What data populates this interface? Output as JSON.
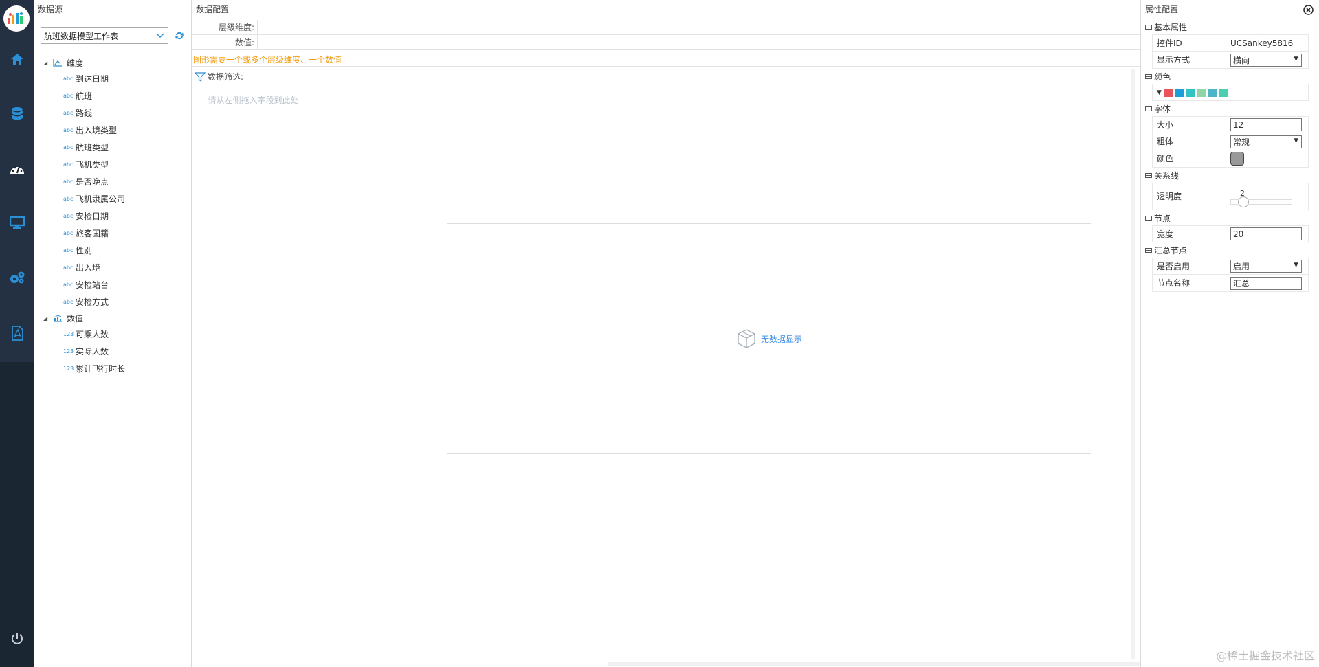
{
  "rail": {
    "icons": [
      "logo-icon",
      "home-icon",
      "database-icon",
      "dashboard-icon",
      "monitor-icon",
      "settings-icon",
      "pdf-icon",
      "power-icon"
    ]
  },
  "datasource": {
    "title": "数据源",
    "selected": "航班数据模型工作表",
    "groups": [
      {
        "label": "维度",
        "tag": "abc",
        "items": [
          "到达日期",
          "航班",
          "路线",
          "出入境类型",
          "航班类型",
          "飞机类型",
          "是否晚点",
          "飞机隶属公司",
          "安检日期",
          "旅客国籍",
          "性别",
          "出入境",
          "安检站台",
          "安检方式"
        ]
      },
      {
        "label": "数值",
        "tag": "123",
        "items": [
          "可乘人数",
          "实际人数",
          "累计飞行时长"
        ]
      }
    ]
  },
  "dataconfig": {
    "title": "数据配置",
    "level_dim_label": "层级维度:",
    "value_label": "数值:",
    "warning": "图形需要一个或多个层级维度、一个数值",
    "filter_label": "数据筛选:",
    "filter_hint": "请从左侧拖入字段到此处",
    "no_data": "无数据显示"
  },
  "props": {
    "title": "属性配置",
    "sections": {
      "basic": "基本属性",
      "color": "颜色",
      "font": "字体",
      "link": "关系线",
      "node": "节点",
      "summary": "汇总节点"
    },
    "control_id_label": "控件ID",
    "control_id": "UCSankey5816",
    "display_label": "显示方式",
    "display_value": "横向",
    "palette": [
      "#e8545a",
      "#1e9ed8",
      "#33c3c3",
      "#8fd5a6",
      "#4cb6c8",
      "#4ccfb0"
    ],
    "size_label": "大小",
    "size_value": "12",
    "bold_label": "粗体",
    "bold_value": "常规",
    "font_color_label": "颜色",
    "font_color": "#999999",
    "opacity_label": "透明度",
    "opacity_value": "2",
    "width_label": "宽度",
    "width_value": "20",
    "enable_label": "是否启用",
    "enable_value": "启用",
    "node_name_label": "节点名称",
    "node_name_value": "汇总"
  },
  "watermark": "@稀土掘金技术社区"
}
